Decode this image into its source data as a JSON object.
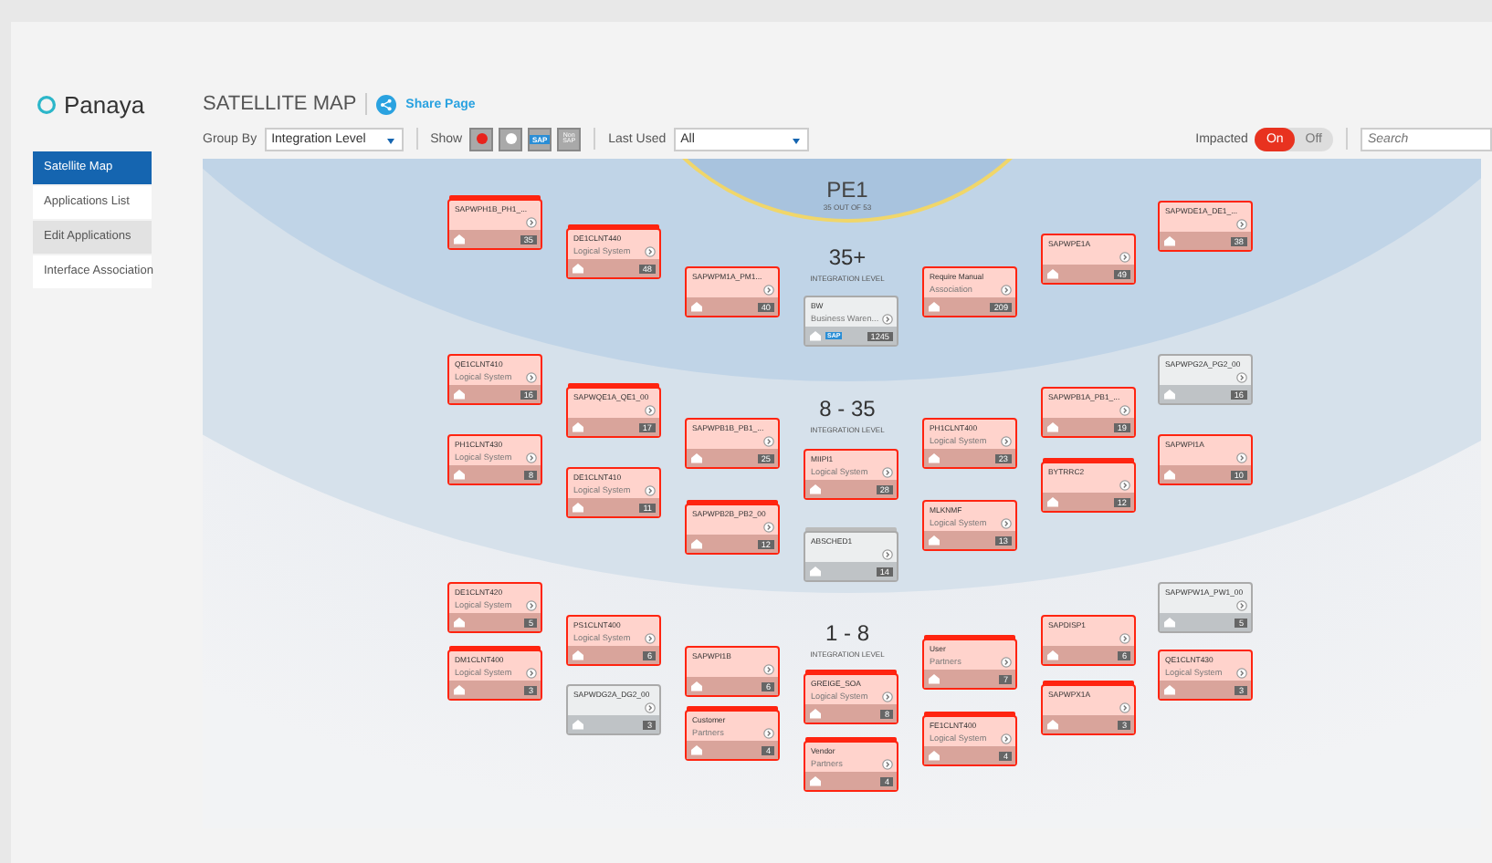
{
  "logo": "Panaya",
  "sidebar": {
    "items": [
      {
        "label": "Satellite Map",
        "selected": true,
        "highlighted": false
      },
      {
        "label": "Applications List",
        "selected": false,
        "highlighted": false
      },
      {
        "label": "Edit Applications",
        "selected": false,
        "highlighted": true
      },
      {
        "label": "Interface Association",
        "selected": false,
        "highlighted": false
      }
    ]
  },
  "header": {
    "title": "SATELLITE MAP",
    "share": "Share Page"
  },
  "toolbar": {
    "group_by": {
      "label": "Group By",
      "value": "Integration Level"
    },
    "show": {
      "label": "Show",
      "filters": [
        {
          "kind": "red-dot"
        },
        {
          "kind": "white-dot"
        },
        {
          "kind": "sap",
          "label": "SAP"
        },
        {
          "kind": "non-sap",
          "label": "Non SAP"
        }
      ]
    },
    "last_used": {
      "label": "Last Used",
      "value": "All"
    },
    "impacted": {
      "label": "Impacted",
      "options": [
        {
          "label": "On",
          "selected": true
        },
        {
          "label": "Off",
          "selected": false
        }
      ]
    },
    "search": {
      "placeholder": "Search"
    }
  },
  "map": {
    "center": {
      "title": "PE1",
      "subtitle": "35 OUT OF 53"
    },
    "levels": [
      {
        "range": "35+",
        "label": "INTEGRATION LEVEL"
      },
      {
        "range": "8 - 35",
        "label": "INTEGRATION LEVEL"
      },
      {
        "range": "1 - 8",
        "label": "INTEGRATION LEVEL"
      }
    ],
    "nodes": [
      {
        "name": "SAPWPH1B_PH1_...",
        "count": "35",
        "impacted": true,
        "stacked": true
      },
      {
        "name": "DE1CLNT440",
        "type": "Logical System",
        "count": "48",
        "impacted": true,
        "stacked": true
      },
      {
        "name": "SAPWPM1A_PM1...",
        "count": "40",
        "impacted": true,
        "stacked": false
      },
      {
        "name": "BW",
        "type": "Business Waren...",
        "count": "1245",
        "impacted": false,
        "stacked": false,
        "logo": "SAP"
      },
      {
        "name": "Require Manual",
        "type": "Association",
        "count": "209",
        "impacted": true,
        "stacked": false
      },
      {
        "name": "SAPWPE1A",
        "count": "49",
        "impacted": true,
        "stacked": false
      },
      {
        "name": "SAPWDE1A_DE1_...",
        "count": "38",
        "impacted": true,
        "stacked": false
      },
      {
        "name": "QE1CLNT410",
        "type": "Logical System",
        "count": "16",
        "impacted": true,
        "stacked": false
      },
      {
        "name": "SAPWQE1A_QE1_00",
        "count": "17",
        "impacted": true,
        "stacked": true
      },
      {
        "name": "SAPWPB1B_PB1_...",
        "count": "25",
        "impacted": true,
        "stacked": false
      },
      {
        "name": "MIIPI1",
        "type": "Logical System",
        "count": "28",
        "impacted": true,
        "stacked": false
      },
      {
        "name": "PH1CLNT400",
        "type": "Logical System",
        "count": "23",
        "impacted": true,
        "stacked": false
      },
      {
        "name": "SAPWPB1A_PB1_...",
        "count": "19",
        "impacted": true,
        "stacked": false
      },
      {
        "name": "SAPWPG2A_PG2_00",
        "count": "16",
        "impacted": false,
        "stacked": false
      },
      {
        "name": "PH1CLNT430",
        "type": "Logical System",
        "count": "8",
        "impacted": true,
        "stacked": false
      },
      {
        "name": "DE1CLNT410",
        "type": "Logical System",
        "count": "11",
        "impacted": true,
        "stacked": false
      },
      {
        "name": "SAPWPB2B_PB2_00",
        "count": "12",
        "impacted": true,
        "stacked": true
      },
      {
        "name": "ABSCHED1",
        "count": "14",
        "impacted": false,
        "stacked": true
      },
      {
        "name": "MLKNMF",
        "type": "Logical System",
        "count": "13",
        "impacted": true,
        "stacked": false
      },
      {
        "name": "BYTRRC2",
        "count": "12",
        "impacted": true,
        "stacked": true
      },
      {
        "name": "SAPWPI1A",
        "count": "10",
        "impacted": true,
        "stacked": false
      },
      {
        "name": "DE1CLNT420",
        "type": "Logical System",
        "count": "5",
        "impacted": true,
        "stacked": false
      },
      {
        "name": "PS1CLNT400",
        "type": "Logical System",
        "count": "6",
        "impacted": true,
        "stacked": false
      },
      {
        "name": "SAPWPI1B",
        "count": "6",
        "impacted": true,
        "stacked": false
      },
      {
        "name": "GREIGE_SOA",
        "type": "Logical System",
        "count": "8",
        "impacted": true,
        "stacked": true
      },
      {
        "name": "User",
        "type": "Partners",
        "count": "7",
        "impacted": true,
        "stacked": true
      },
      {
        "name": "SAPDISP1",
        "count": "6",
        "impacted": true,
        "stacked": false
      },
      {
        "name": "SAPWPW1A_PW1_00",
        "count": "5",
        "impacted": false,
        "stacked": false
      },
      {
        "name": "DM1CLNT400",
        "type": "Logical System",
        "count": "3",
        "impacted": true,
        "stacked": true
      },
      {
        "name": "SAPWDG2A_DG2_00",
        "count": "3",
        "impacted": false,
        "stacked": false
      },
      {
        "name": "Customer",
        "type": "Partners",
        "count": "4",
        "impacted": true,
        "stacked": true
      },
      {
        "name": "Vendor",
        "type": "Partners",
        "count": "4",
        "impacted": true,
        "stacked": true
      },
      {
        "name": "FE1CLNT400",
        "type": "Logical System",
        "count": "4",
        "impacted": true,
        "stacked": true
      },
      {
        "name": "SAPWPX1A",
        "count": "3",
        "impacted": true,
        "stacked": true
      },
      {
        "name": "QE1CLNT430",
        "type": "Logical System",
        "count": "3",
        "impacted": true,
        "stacked": false
      }
    ]
  }
}
